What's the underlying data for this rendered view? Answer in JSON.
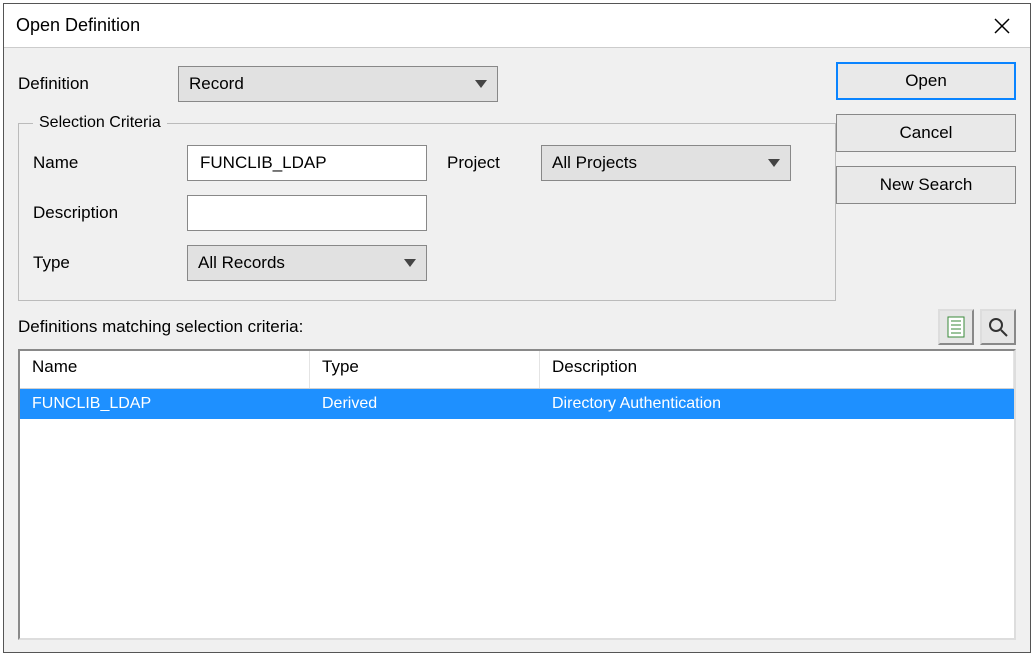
{
  "dialog": {
    "title": "Open Definition",
    "close_icon": "close"
  },
  "form": {
    "definition_label": "Definition",
    "definition_value": "Record",
    "selection_legend": "Selection Criteria",
    "name_label": "Name",
    "name_value": "FUNCLIB_LDAP",
    "project_label": "Project",
    "project_value": "All Projects",
    "description_label": "Description",
    "description_value": "",
    "type_label": "Type",
    "type_value": "All Records"
  },
  "buttons": {
    "open": "Open",
    "cancel": "Cancel",
    "new_search": "New Search"
  },
  "results": {
    "caption": "Definitions matching selection criteria:",
    "columns": {
      "name": "Name",
      "type": "Type",
      "description": "Description"
    },
    "rows": [
      {
        "name": "FUNCLIB_LDAP",
        "type": "Derived",
        "description": "Directory Authentication"
      }
    ]
  },
  "icons": {
    "list_sheet": "list-sheet-icon",
    "magnifier": "magnifier-icon"
  }
}
